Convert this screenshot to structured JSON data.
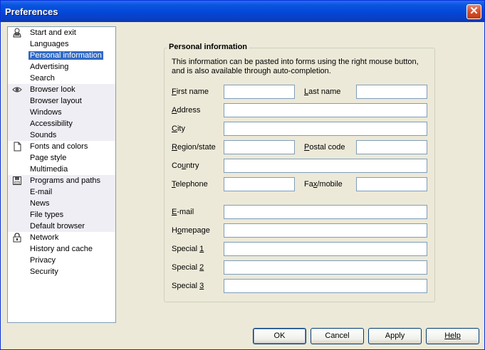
{
  "window": {
    "title": "Preferences"
  },
  "nav": {
    "groups": [
      {
        "icon": "person-icon",
        "items": [
          "Start and exit",
          "Languages",
          "Personal information",
          "Advertising",
          "Search"
        ]
      },
      {
        "icon": "eye-icon",
        "items": [
          "Browser look",
          "Browser layout",
          "Windows",
          "Accessibility",
          "Sounds"
        ]
      },
      {
        "icon": "document-icon",
        "items": [
          "Fonts and colors",
          "Page style",
          "Multimedia"
        ]
      },
      {
        "icon": "disk-icon",
        "items": [
          "Programs and paths",
          "E-mail",
          "News",
          "File types",
          "Default browser"
        ]
      },
      {
        "icon": "lock-icon",
        "items": [
          "Network",
          "History and cache",
          "Privacy",
          "Security"
        ]
      }
    ],
    "selected": "Personal information"
  },
  "panel": {
    "title": "Personal information",
    "description": "This information can be pasted into forms using the right mouse button, and is also available through auto-completion.",
    "fields": {
      "first_name": {
        "label_pre": "",
        "label_key": "F",
        "label_post": "irst name",
        "value": ""
      },
      "last_name": {
        "label_pre": "",
        "label_key": "L",
        "label_post": "ast name",
        "value": ""
      },
      "address": {
        "label_pre": "",
        "label_key": "A",
        "label_post": "ddress",
        "value": ""
      },
      "city": {
        "label_pre": "",
        "label_key": "C",
        "label_post": "ity",
        "value": ""
      },
      "region": {
        "label_pre": "",
        "label_key": "R",
        "label_post": "egion/state",
        "value": ""
      },
      "postal": {
        "label_pre": "",
        "label_key": "P",
        "label_post": "ostal code",
        "value": ""
      },
      "country": {
        "label_pre": "Co",
        "label_key": "u",
        "label_post": "ntry",
        "value": ""
      },
      "telephone": {
        "label_pre": "",
        "label_key": "T",
        "label_post": "elephone",
        "value": ""
      },
      "fax": {
        "label_pre": "Fa",
        "label_key": "x",
        "label_post": "/mobile",
        "value": ""
      },
      "email": {
        "label_pre": "",
        "label_key": "E",
        "label_post": "-mail",
        "value": ""
      },
      "homepage": {
        "label_pre": "H",
        "label_key": "o",
        "label_post": "mepage",
        "value": ""
      },
      "special1": {
        "label_pre": "Special ",
        "label_key": "1",
        "label_post": "",
        "value": ""
      },
      "special2": {
        "label_pre": "Special ",
        "label_key": "2",
        "label_post": "",
        "value": ""
      },
      "special3": {
        "label_pre": "Special ",
        "label_key": "3",
        "label_post": "",
        "value": ""
      }
    }
  },
  "buttons": {
    "ok": "OK",
    "cancel": "Cancel",
    "apply": "Apply",
    "help": "Help"
  }
}
